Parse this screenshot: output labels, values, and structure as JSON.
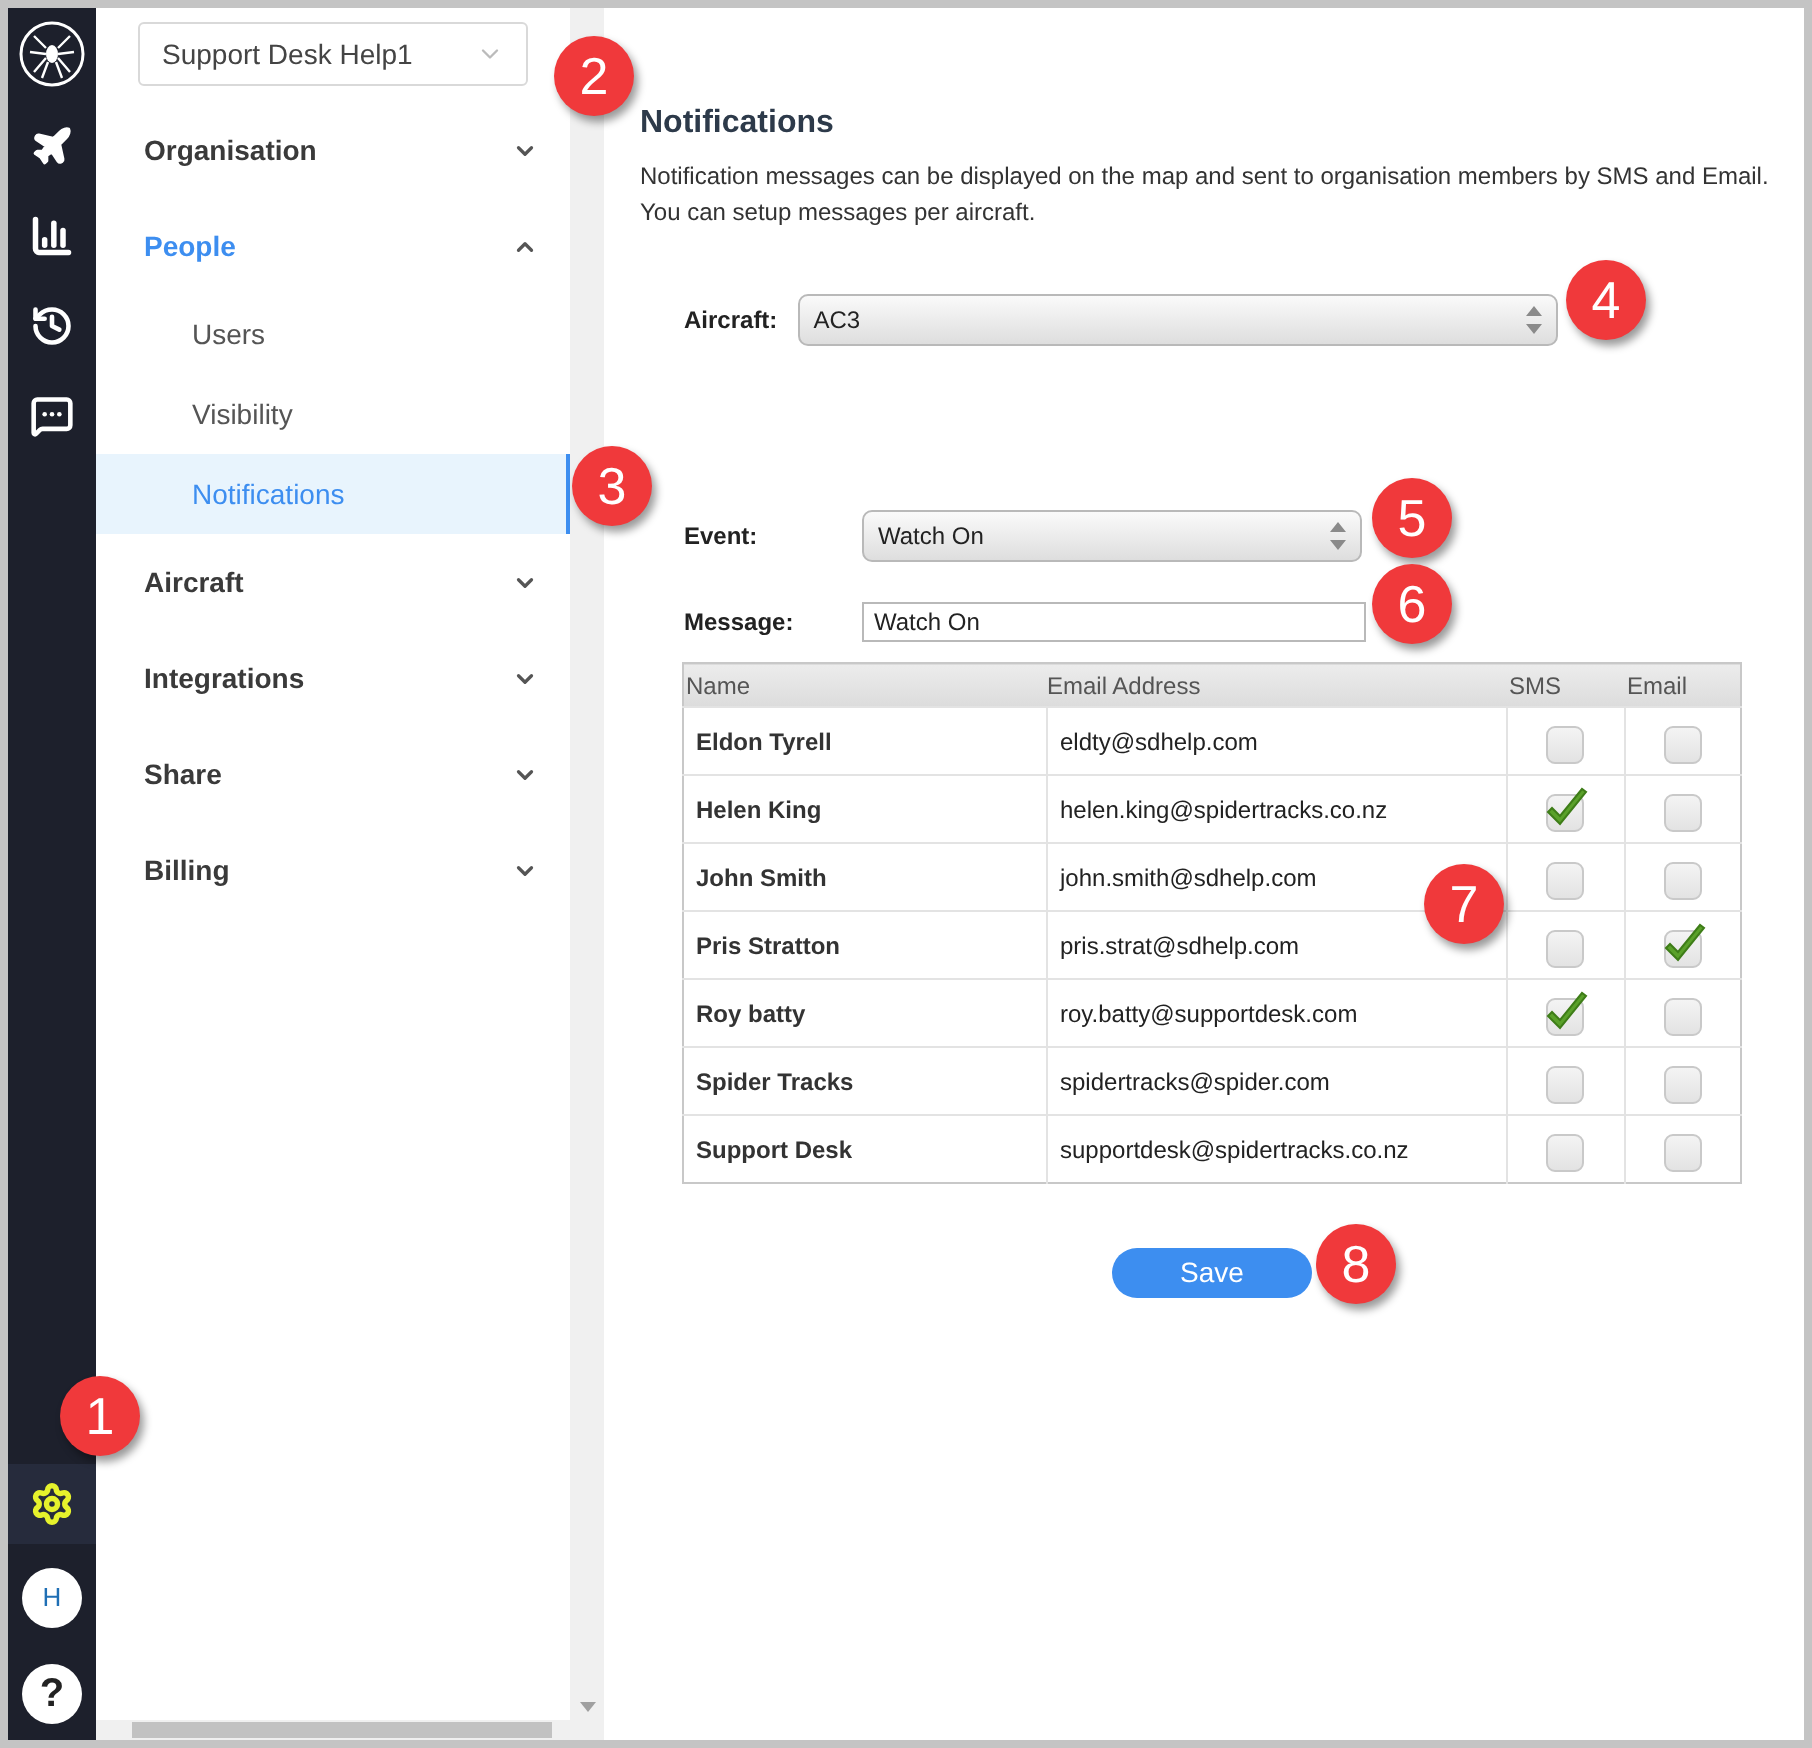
{
  "rail": {
    "items": [
      {
        "kind": "logo",
        "selected": false
      },
      {
        "kind": "plane",
        "selected": false
      },
      {
        "kind": "chart",
        "selected": false
      },
      {
        "kind": "history",
        "selected": false
      },
      {
        "kind": "chat",
        "selected": false
      }
    ],
    "bottom": [
      {
        "kind": "settings",
        "selected": true
      }
    ],
    "avatar": "H",
    "help": "?"
  },
  "sidebar": {
    "account": "Support Desk Help1",
    "items": [
      {
        "label": "Organisation",
        "expanded": false,
        "selected": false
      },
      {
        "label": "People",
        "expanded": true,
        "selected": true,
        "children": [
          {
            "label": "Users",
            "selected": false
          },
          {
            "label": "Visibility",
            "selected": false
          },
          {
            "label": "Notifications",
            "selected": true
          }
        ]
      },
      {
        "label": "Aircraft",
        "expanded": false,
        "selected": false
      },
      {
        "label": "Integrations",
        "expanded": false,
        "selected": false
      },
      {
        "label": "Share",
        "expanded": false,
        "selected": false
      },
      {
        "label": "Billing",
        "expanded": false,
        "selected": false
      }
    ]
  },
  "main": {
    "title": "Notifications",
    "description": "Notification messages can be displayed on the map and sent to organisation members by SMS and Email. You can setup messages per aircraft.",
    "aircraft": {
      "label": "Aircraft:",
      "value": "AC3"
    },
    "event": {
      "label": "Event:",
      "value": "Watch On"
    },
    "message": {
      "label": "Message:",
      "value": "Watch On"
    },
    "table": {
      "columns": [
        "Name",
        "Email Address",
        "SMS",
        "Email"
      ],
      "rows": [
        {
          "name": "Eldon Tyrell",
          "email": "eldty@sdhelp.com",
          "sms": false,
          "email_on": false
        },
        {
          "name": "Helen King",
          "email": "helen.king@spidertracks.co.nz",
          "sms": true,
          "email_on": false
        },
        {
          "name": "John Smith",
          "email": "john.smith@sdhelp.com",
          "sms": false,
          "email_on": false
        },
        {
          "name": "Pris Stratton",
          "email": "pris.strat@sdhelp.com",
          "sms": false,
          "email_on": true
        },
        {
          "name": "Roy batty",
          "email": "roy.batty@supportdesk.com",
          "sms": true,
          "email_on": false
        },
        {
          "name": "Spider Tracks",
          "email": "spidertracks@spider.com",
          "sms": false,
          "email_on": false
        },
        {
          "name": "Support Desk",
          "email": "supportdesk@spidertracks.co.nz",
          "sms": false,
          "email_on": false
        }
      ]
    },
    "save": "Save"
  },
  "callouts": [
    "1",
    "2",
    "3",
    "4",
    "5",
    "6",
    "7",
    "8"
  ]
}
